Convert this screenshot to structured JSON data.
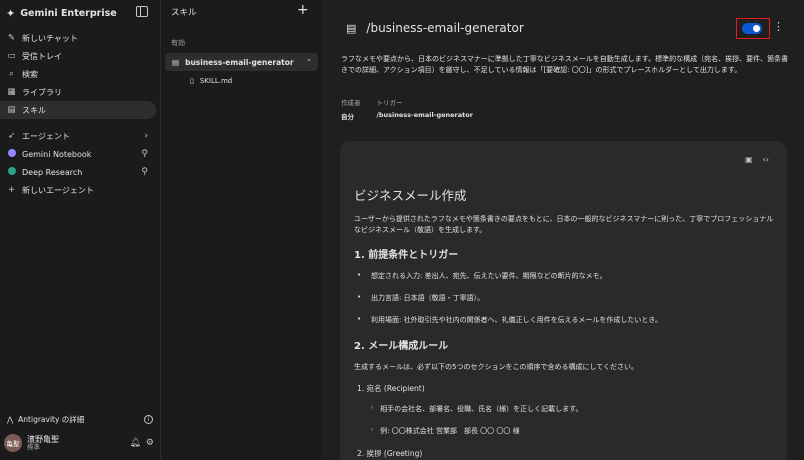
{
  "sidebar": {
    "app_name": "Gemini Enterprise",
    "nav": [
      {
        "label": "新しいチャット",
        "icon": "edit-icon"
      },
      {
        "label": "受信トレイ",
        "icon": "inbox-icon"
      },
      {
        "label": "検索",
        "icon": "search-icon"
      },
      {
        "label": "ライブラリ",
        "icon": "library-icon"
      },
      {
        "label": "スキル",
        "icon": "skill-doc-icon",
        "active": true
      }
    ],
    "agents": [
      {
        "label": "エージェント",
        "icon": "rocket-icon"
      },
      {
        "label": "Gemini Notebook",
        "icon": "gemini-icon"
      },
      {
        "label": "Deep Research",
        "icon": "deep-research-icon"
      },
      {
        "label": "新しいエージェント",
        "icon": "plus-icon"
      }
    ],
    "footer": {
      "antigravity_label": "Antigravity の詳細",
      "avatar_initials": "亀聖",
      "user_name": "濱野亀聖",
      "user_role": "標準"
    }
  },
  "skills_panel": {
    "title": "スキル",
    "section_label": "有効",
    "skill_name": "business-email-generator",
    "file_name": "SKILL.md"
  },
  "detail": {
    "title": "/business-email-generator",
    "toggle_on": true,
    "description": "ラフなメモや要点から、日本のビジネスマナーに準拠した丁寧なビジネスメールを自動生成します。標準的な構成（宛名、挨拶、要件、箇条書きでの詳細、アクション項目）を厳守し、不足している情報は「[要確認: 〇〇]」の形式でプレースホルダーとして出力します。",
    "meta": {
      "author_label": "作成者",
      "author_value": "自分",
      "trigger_label": "トリガー",
      "trigger_value": "/business-email-generator"
    },
    "doc": {
      "h1": "ビジネスメール作成",
      "intro": "ユーザーから提供されたラフなメモや箇条書きの要点をもとに、日本の一般的なビジネスマナーに則った、丁寧でプロフェッショナルなビジネスメール（敬語）を生成します。",
      "h2_1": "1. 前提条件とトリガー",
      "bullets": [
        "想定される入力: 差出人、宛先、伝えたい要件、期限などの断片的なメモ。",
        "出力言語: 日本語（敬語・丁寧語）。",
        "利用場面: 社外取引先や社内の関係者へ、礼儀正しく用件を伝えるメールを作成したいとき。"
      ],
      "h2_2": "2. メール構成ルール",
      "rule_intro": "生成するメールは、必ず以下の5つのセクションをこの順序で含める構成にしてください。",
      "item1": "1. 宛名 (Recipient)",
      "item1_subs": [
        "相手の会社名、部署名、役職、氏名（様）を正しく記載します。",
        "例: 〇〇株式会社 営業部　部長 〇〇 〇〇 様"
      ],
      "item2": "2. 挨拶 (Greeting)"
    }
  },
  "colors": {
    "accent_toggle": "#0b57d0",
    "highlight_box": "#e31d1d",
    "background": "#1f1f1f",
    "card": "#282a2c"
  }
}
